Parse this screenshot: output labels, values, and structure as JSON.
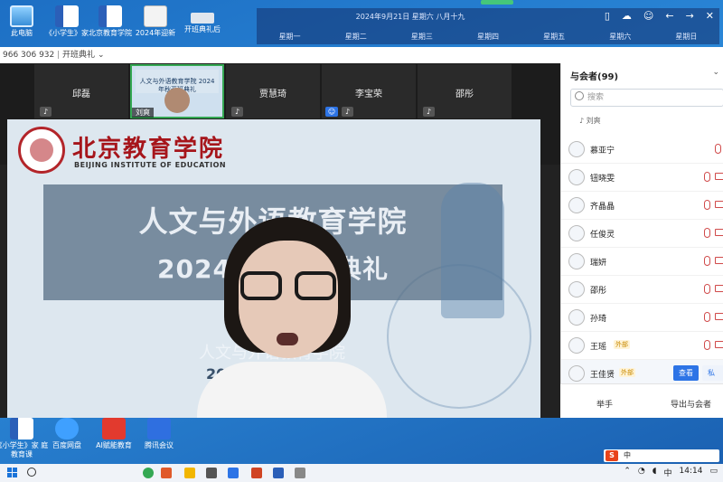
{
  "desktop": {
    "icons": [
      {
        "label": "此电脑"
      },
      {
        "label": "《小学生》家"
      },
      {
        "label": "北京教育学院"
      },
      {
        "label": "2024年迎新"
      },
      {
        "label": "开班典礼后"
      },
      {
        "label": "《小学生》家 庭教育课"
      },
      {
        "label": "百度网盘"
      },
      {
        "label": "AI赋能教育"
      },
      {
        "label": "腾讯会议"
      }
    ]
  },
  "calendar": {
    "date_text": "2024年9月21日 星期六 八月十九",
    "weekdays": [
      "星期一",
      "星期二",
      "星期三",
      "星期四",
      "星期五",
      "星期六",
      "星期日"
    ]
  },
  "meeting": {
    "meeting_id": "966 306 932",
    "meeting_name": "开班典礼",
    "tiles": [
      {
        "name": "邱磊"
      },
      {
        "name": "刘爽",
        "slide_text": "人文与外语教育学院 2024年秋开班典礼"
      },
      {
        "name": "贾慧琦"
      },
      {
        "name": "李宝荣"
      },
      {
        "name": "邵彤"
      }
    ],
    "slide": {
      "institute_cn": "北京教育学院",
      "institute_en": "BEIJING INSTITUTE OF EDUCATION",
      "title_line1": "人文与外语教育学院",
      "title_line2": "2024年秋开班典礼",
      "lower_line1": "人文与外语教育学院",
      "lower_line2": "2024年"
    }
  },
  "panel": {
    "title": "与会者(99)",
    "search_placeholder": "搜索",
    "speaking_label": "刘爽",
    "participants": [
      {
        "name": "慕亚宁",
        "tag": ""
      },
      {
        "name": "钮晓雯",
        "tag": ""
      },
      {
        "name": "齐晶晶",
        "tag": ""
      },
      {
        "name": "任俊灵",
        "tag": ""
      },
      {
        "name": "瑞妍",
        "tag": ""
      },
      {
        "name": "邵彤",
        "tag": ""
      },
      {
        "name": "孙琦",
        "tag": ""
      },
      {
        "name": "王瑶",
        "tag": "外部"
      },
      {
        "name": "王佳贤",
        "tag": "外部",
        "actions": [
          "查看",
          "私聊"
        ]
      }
    ],
    "footer": {
      "raise_hand": "举手",
      "export": "导出与会者"
    }
  },
  "taskbar": {
    "time": "14:14",
    "ime_lang": "中"
  }
}
